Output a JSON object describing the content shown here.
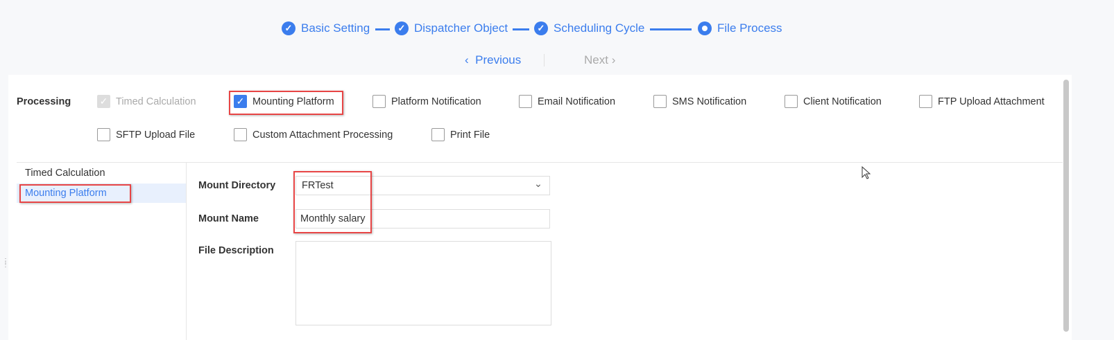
{
  "steps": [
    {
      "label": "Basic Setting",
      "state": "done"
    },
    {
      "label": "Dispatcher Object",
      "state": "done"
    },
    {
      "label": "Scheduling Cycle",
      "state": "done"
    },
    {
      "label": "File Process",
      "state": "current"
    }
  ],
  "nav": {
    "previous": "Previous",
    "next": "Next"
  },
  "processing": {
    "label": "Processing",
    "options": [
      {
        "label": "Timed Calculation",
        "checked": true,
        "disabled": true
      },
      {
        "label": "Mounting Platform",
        "checked": true
      },
      {
        "label": "Platform Notification",
        "checked": false
      },
      {
        "label": "Email Notification",
        "checked": false
      },
      {
        "label": "SMS Notification",
        "checked": false
      },
      {
        "label": "Client Notification",
        "checked": false
      },
      {
        "label": "FTP Upload Attachment",
        "checked": false
      },
      {
        "label": "SFTP Upload File",
        "checked": false
      },
      {
        "label": "Custom Attachment Processing",
        "checked": false
      },
      {
        "label": "Print File",
        "checked": false
      }
    ]
  },
  "side": {
    "items": [
      "Timed Calculation",
      "Mounting Platform"
    ],
    "active": 1
  },
  "form": {
    "mount_directory_label": "Mount Directory",
    "mount_directory_value": "FRTest",
    "mount_name_label": "Mount Name",
    "mount_name_value": "Monthly salary",
    "file_description_label": "File Description",
    "file_description_value": ""
  },
  "colors": {
    "accent": "#3b7ded",
    "highlight": "#e84545"
  }
}
